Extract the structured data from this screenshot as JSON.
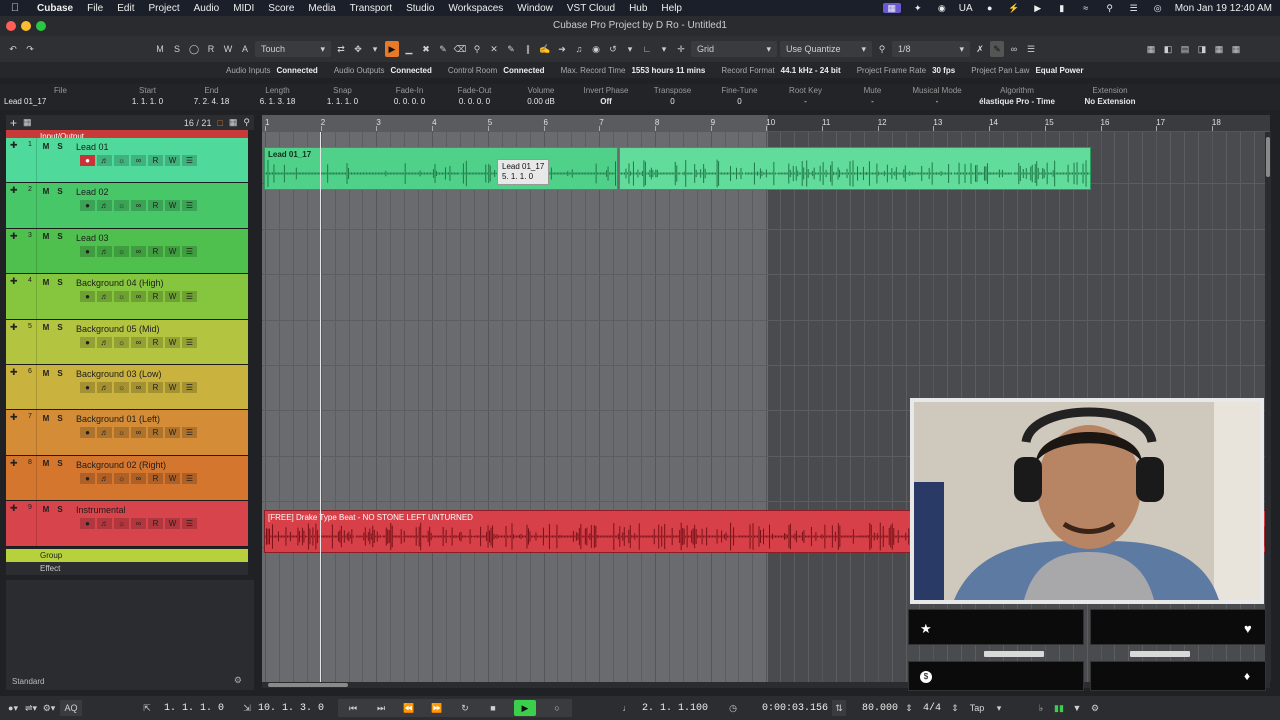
{
  "menubar": {
    "items": [
      "Cubase",
      "File",
      "Edit",
      "Project",
      "Audio",
      "MIDI",
      "Score",
      "Media",
      "Transport",
      "Studio",
      "Workspaces",
      "Window",
      "VST Cloud",
      "Hub",
      "Help"
    ],
    "language": "UA",
    "datetime": "Mon Jan 19  12:40 AM"
  },
  "window": {
    "title": "Cubase Pro Project by D Ro - Untitled1"
  },
  "toolbar": {
    "buttons_msrwa": [
      "M",
      "S",
      "R",
      "W",
      "A"
    ],
    "automation_mode": "Touch",
    "snap_type": "Grid",
    "quantize_mode": "Use Quantize",
    "quantize_value": "1/8"
  },
  "status": {
    "items": [
      {
        "label": "Audio Inputs",
        "value": "Connected"
      },
      {
        "label": "Audio Outputs",
        "value": "Connected"
      },
      {
        "label": "Control Room",
        "value": "Connected"
      },
      {
        "label": "Max. Record Time",
        "value": "1553 hours 11 mins"
      },
      {
        "label": "Record Format",
        "value": "44.1 kHz - 24 bit"
      },
      {
        "label": "Project Frame Rate",
        "value": "30 fps"
      },
      {
        "label": "Project Pan Law",
        "value": "Equal Power"
      }
    ]
  },
  "infoline": [
    {
      "label": "File",
      "value": "Lead 01_17"
    },
    {
      "label": "Start",
      "value": "1. 1. 1.   0"
    },
    {
      "label": "End",
      "value": "7. 2. 4. 18"
    },
    {
      "label": "Length",
      "value": "6. 1. 3. 18"
    },
    {
      "label": "Snap",
      "value": "1. 1. 1.   0"
    },
    {
      "label": "Fade-In",
      "value": "0. 0. 0.   0"
    },
    {
      "label": "Fade-Out",
      "value": "0. 0. 0.   0"
    },
    {
      "label": "Volume",
      "value": "0.00    dB"
    },
    {
      "label": "Invert Phase",
      "value": "Off"
    },
    {
      "label": "Transpose",
      "value": "0"
    },
    {
      "label": "Fine-Tune",
      "value": "0"
    },
    {
      "label": "Root Key",
      "value": "-"
    },
    {
      "label": "Mute",
      "value": "-"
    },
    {
      "label": "Musical Mode",
      "value": "-"
    },
    {
      "label": "Algorithm",
      "value": "élastique Pro - Time"
    },
    {
      "label": "Extension",
      "value": "No Extension"
    }
  ],
  "trackhead": {
    "count": "16 / 21"
  },
  "tracks": [
    {
      "num": "1",
      "name": "Lead 01",
      "color": "#4fd99a"
    },
    {
      "num": "2",
      "name": "Lead 02",
      "color": "#48c768"
    },
    {
      "num": "3",
      "name": "Lead 03",
      "color": "#4fc04e"
    },
    {
      "num": "4",
      "name": "Background 04 (High)",
      "color": "#86c63f"
    },
    {
      "num": "5",
      "name": "Background 05 (Mid)",
      "color": "#b3c440"
    },
    {
      "num": "6",
      "name": "Background 03 (Low)",
      "color": "#c9b23d"
    },
    {
      "num": "7",
      "name": "Background 01 (Left)",
      "color": "#d48c36"
    },
    {
      "num": "8",
      "name": "Background 02 (Right)",
      "color": "#d5762f"
    },
    {
      "num": "9",
      "name": "Instrumental",
      "color": "#d8444c"
    }
  ],
  "folders": {
    "input_output": "Input/Output",
    "group": "Group",
    "effect": "Effect"
  },
  "workspace_label": "Standard",
  "ruler": {
    "bars": [
      "1",
      "2",
      "3",
      "4",
      "5",
      "6",
      "7",
      "8",
      "9",
      "10",
      "11",
      "12",
      "13",
      "14",
      "15",
      "16",
      "17",
      "18"
    ]
  },
  "clips": {
    "lead": "Lead 01_17",
    "tooltip_name": "Lead 01_17",
    "tooltip_pos": "5. 1. 1.   0",
    "instrumental": "[FREE] Drake Type Beat - NO STONE LEFT UNTURNED"
  },
  "transport": {
    "left_locator": "1. 1. 1.   0",
    "right_locator": "10. 1. 3.   0",
    "position_bars": "2. 1. 1.100",
    "position_time": "0:00:03.156",
    "tempo": "80.000",
    "signature": "4/4",
    "tap": "Tap"
  },
  "colors": {
    "accent": "#e57b2a",
    "play": "#3bcf4c",
    "lead_clip": "#4fd18a",
    "instrumental_clip": "#d74048"
  }
}
